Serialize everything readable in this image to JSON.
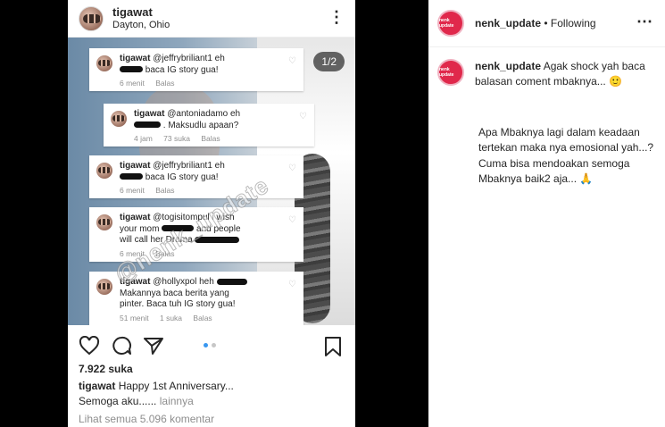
{
  "post": {
    "username": "tigawat",
    "location": "Dayton, Ohio",
    "counter": "1/2",
    "watermark": "@nenk_update",
    "likes": "7.922 suka",
    "caption_user": "tigawat",
    "caption_line1": "Happy 1st Anniversary...",
    "caption_line2": "Semoga aku......",
    "caption_more": "lainnya",
    "view_all": "Lihat semua 5.096 komentar"
  },
  "comments": [
    {
      "user": "tigawat",
      "text1": "@jeffrybriliant1 eh",
      "text2": "baca IG story gua!",
      "time": "6 menit",
      "likes": "",
      "reply": "Balas"
    },
    {
      "user": "tigawat",
      "text1": "@antoniadamo eh",
      "text2": ". Maksudlu apaan?",
      "time": "4 jam",
      "likes": "73 suka",
      "reply": "Balas"
    },
    {
      "user": "tigawat",
      "text1": "@jeffrybriliant1 eh",
      "text2": "baca IG story gua!",
      "time": "6 menit",
      "likes": "",
      "reply": "Balas"
    },
    {
      "user": "tigawat",
      "text1": "@togisitompul i wish",
      "text2": "your mom",
      "text3": "and people",
      "text4": "will call her Drama",
      "time": "6 menit",
      "likes": "",
      "reply": "Balas"
    },
    {
      "user": "tigawat",
      "text1": "@hollyxpol heh",
      "text2": "Makannya baca berita yang",
      "text3": "pinter. Baca tuh IG story gua!",
      "time": "51 menit",
      "likes": "1 suka",
      "reply": "Balas"
    }
  ],
  "panel": {
    "username": "nenk_update",
    "following": "• Following",
    "brand_avatar_text": "nenk update",
    "comment_user": "nenk_update",
    "comment_text": "Agak shock yah baca balasan coment mbaknya...",
    "emoji": "🙂",
    "para": "Apa Mbaknya lagi dalam keadaan tertekan maka nya emosional yah...? Cuma bisa mendoakan semoga Mbaknya baik2 aja...",
    "para_emoji": "🙏"
  }
}
